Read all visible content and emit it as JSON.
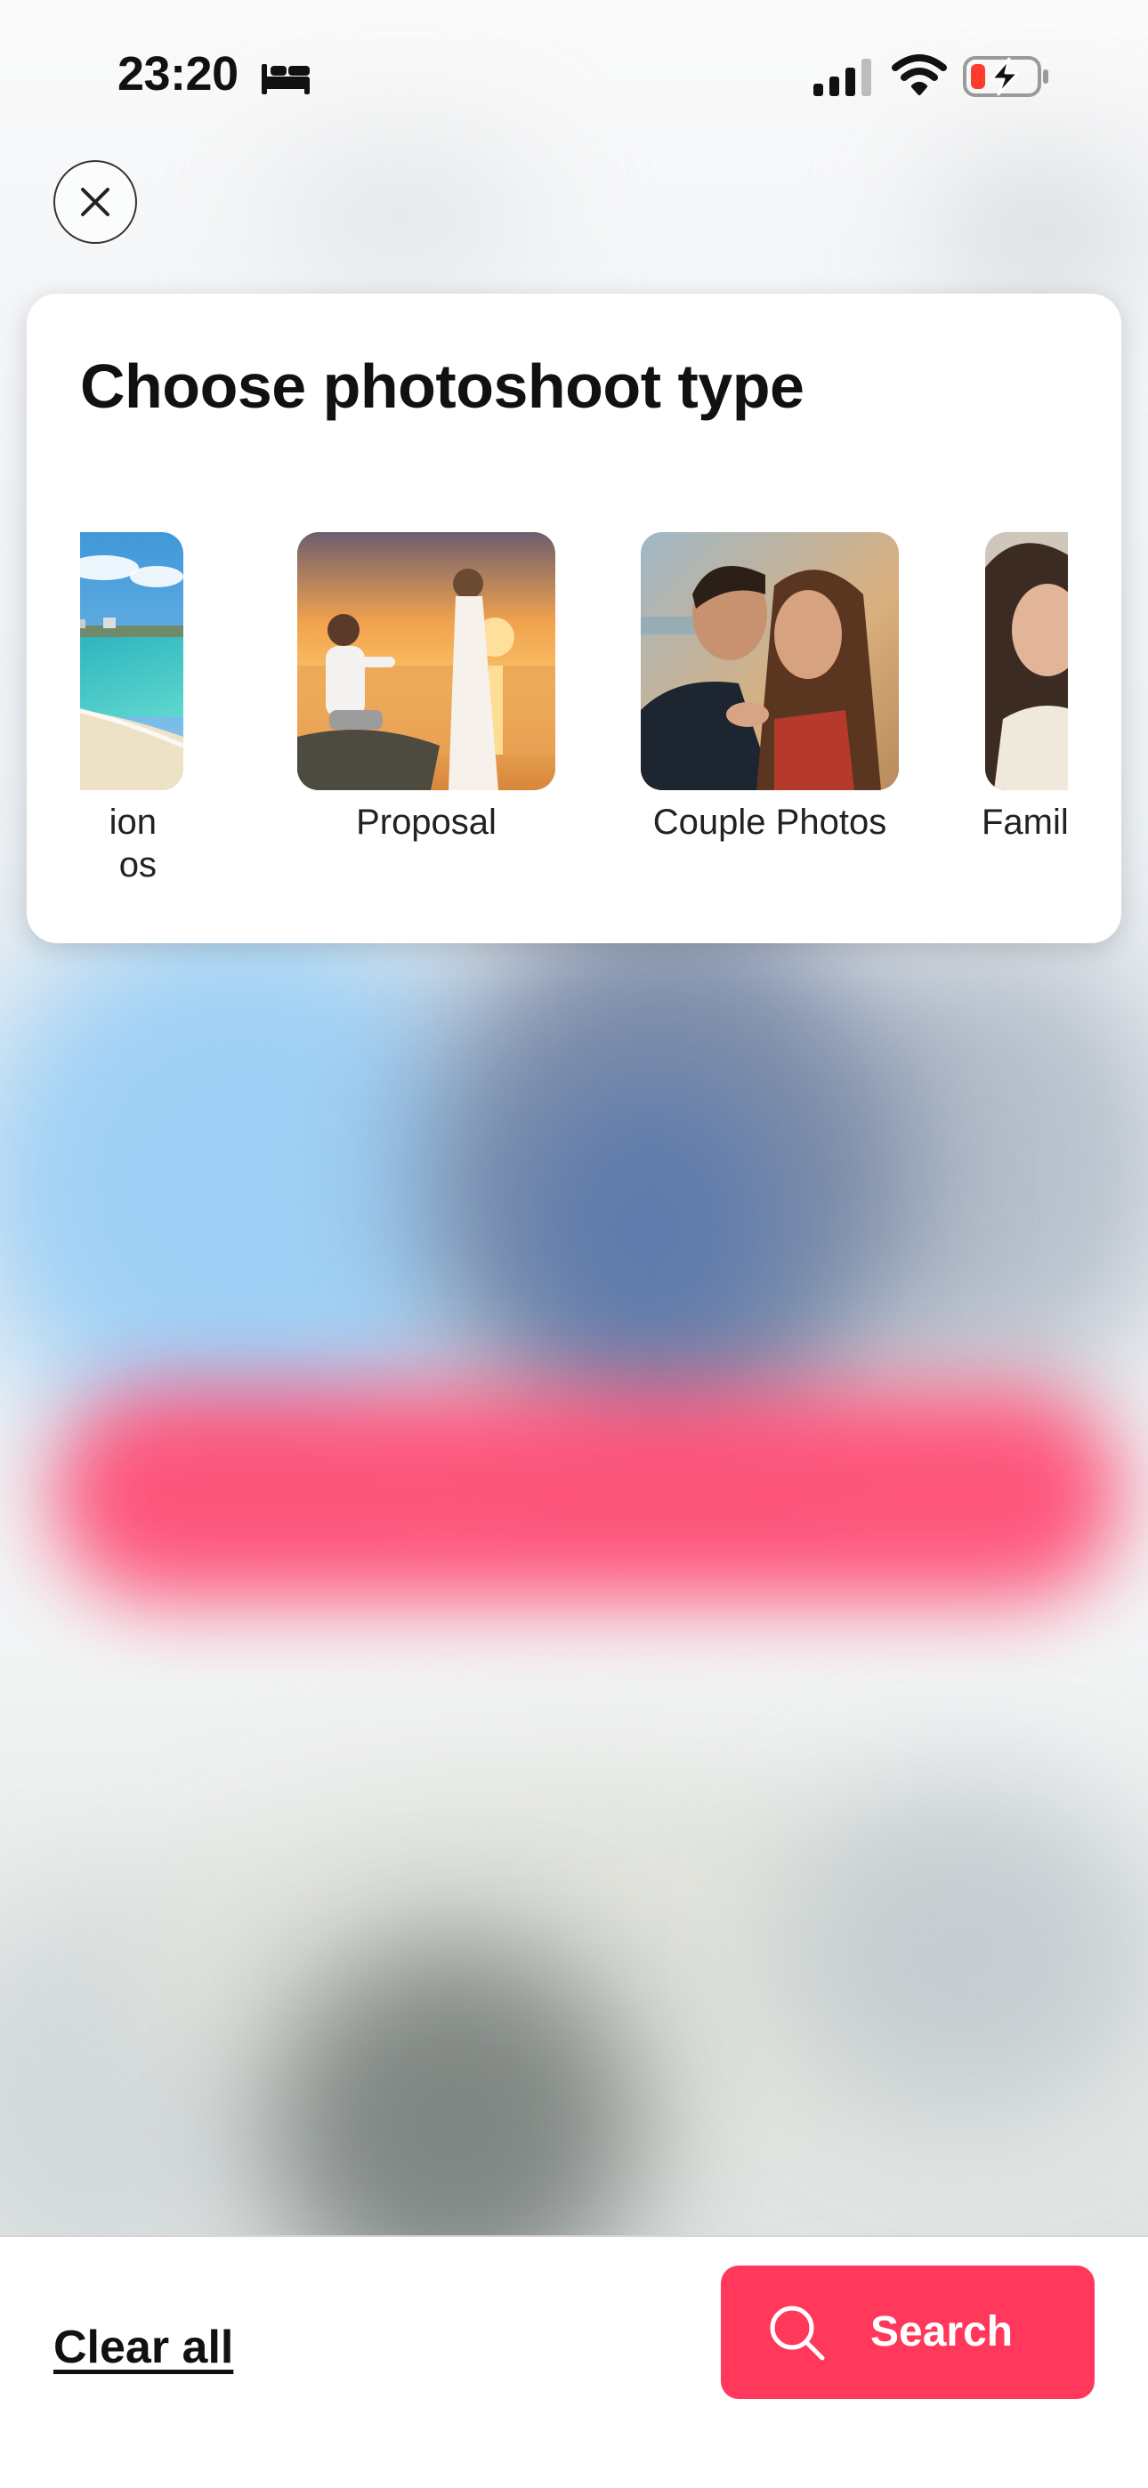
{
  "status_bar": {
    "time": "23:20",
    "icons": [
      "bed-icon",
      "signal-icon",
      "wifi-icon",
      "battery-charging-icon"
    ],
    "battery_level_color": "#ff3b30"
  },
  "close_icon": "close-icon",
  "panel": {
    "title": "Choose photoshoot type",
    "types": [
      {
        "label": "ion\nos",
        "image": "beach-photo"
      },
      {
        "label": "Proposal",
        "image": "proposal-photo"
      },
      {
        "label": "Couple Photos",
        "image": "couple-photo"
      },
      {
        "label": "Family",
        "image": "family-photo"
      }
    ]
  },
  "bottom_bar": {
    "clear_label": "Clear all",
    "search_label": "Search",
    "search_icon": "search-icon"
  },
  "colors": {
    "accent": "#ff385c",
    "text": "#111111"
  }
}
